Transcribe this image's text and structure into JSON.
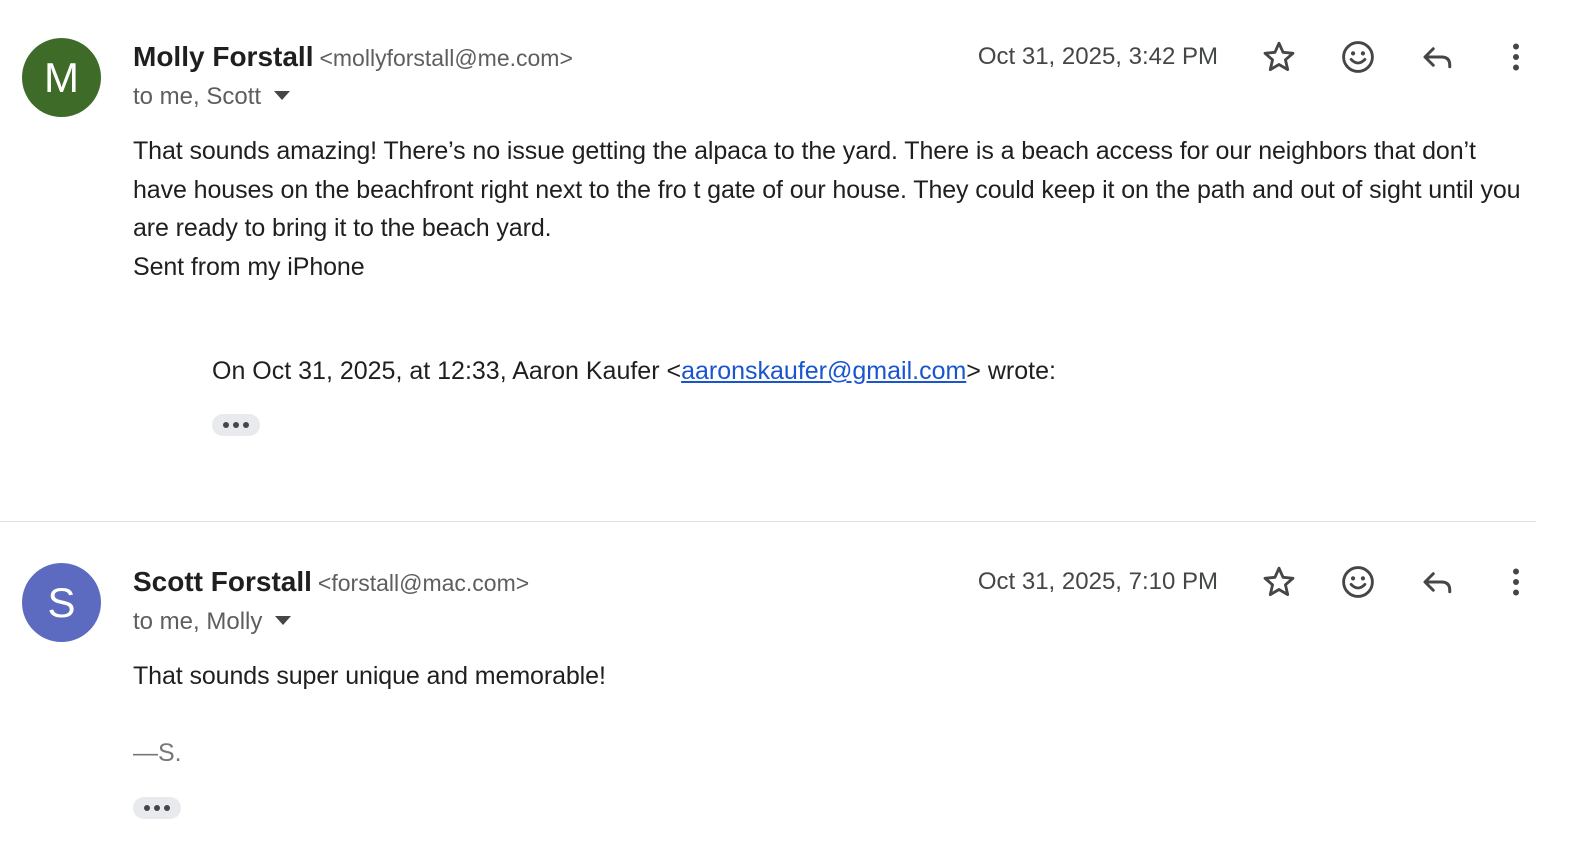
{
  "messages": [
    {
      "avatar_letter": "M",
      "avatar_color": "#3f6b28",
      "sender_name": "Molly Forstall",
      "sender_email": "<mollyforstall@me.com>",
      "recipients": "to me, Scott",
      "timestamp": "Oct 31, 2025, 3:42 PM",
      "body": "That sounds amazing! There’s no issue getting the alpaca to the yard. There is a beach access for our neighbors that don’t have houses on the beachfront right next to the fro t gate of our house. They could keep it on the path and out of sight until you are ready to bring it to the beach yard.",
      "body_line2": "Sent from my iPhone",
      "quote": {
        "prefix": "On Oct 31, 2025, at 12:33, Aaron Kaufer <",
        "email_link": "aaronskaufer@gmail.com",
        "suffix": "> wrote:"
      },
      "icons": [
        "star-icon",
        "emoji-icon",
        "reply-icon",
        "more-vert-icon"
      ]
    },
    {
      "avatar_letter": "S",
      "avatar_color": "#5c6bc0",
      "sender_name": "Scott Forstall",
      "sender_email": "<forstall@mac.com>",
      "recipients": "to me, Molly",
      "timestamp": "Oct 31, 2025, 7:10 PM",
      "body": "That sounds super unique and memorable!",
      "signature": "—S.",
      "icons": [
        "star-icon",
        "emoji-icon",
        "reply-icon",
        "more-vert-icon"
      ]
    }
  ],
  "colors": {
    "link": "#1a55d0",
    "secondary_text": "#5e5e5e",
    "icon": "#444746",
    "divider": "#e3e3e3"
  }
}
